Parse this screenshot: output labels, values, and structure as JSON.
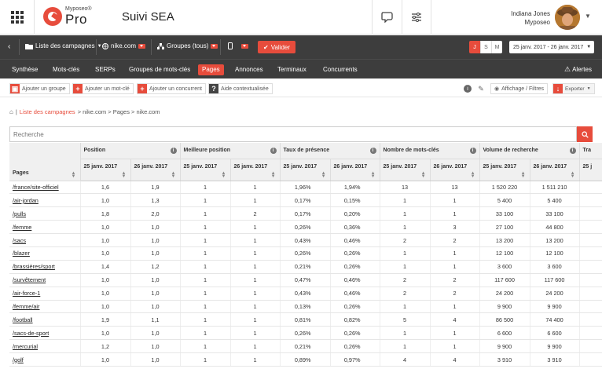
{
  "header": {
    "logo_small": "Myposeo®",
    "logo_big": "Pro",
    "title": "Suivi SEA",
    "user_name": "Indiana Jones",
    "user_org": "Myposeo"
  },
  "toolbar": {
    "campaigns": "Liste des campagnes",
    "domain": "nike.com",
    "groups": "Groupes (tous)",
    "valider": "Valider",
    "period_j": "J",
    "period_s": "S",
    "period_m": "M",
    "date_range": "25 janv. 2017 - 26 janv. 2017"
  },
  "menu": {
    "items": [
      "Synthèse",
      "Mots-clés",
      "SERPs",
      "Groupes de mots-clés",
      "Pages",
      "Annonces",
      "Terminaux",
      "Concurrents"
    ],
    "active": "Pages",
    "alertes": "Alertes"
  },
  "actions": {
    "add_group": "Ajouter un groupe",
    "add_keyword": "Ajouter un mot-clé",
    "add_competitor": "Ajouter un concurrent",
    "help": "Aide contextualisée",
    "display_filters": "Affichage / Filtres",
    "export": "Exporter"
  },
  "breadcrumb": {
    "link": "Liste des campagnes",
    "rest": "> nike.com > Pages > nike.com"
  },
  "search": {
    "placeholder": "Recherche"
  },
  "table": {
    "pages_header": "Pages",
    "groups": [
      "Position",
      "Meilleure position",
      "Taux de présence",
      "Nombre de mots-clés",
      "Volume de recherche",
      "Tra"
    ],
    "date1": "25 janv. 2017",
    "date2": "26 janv. 2017",
    "date3": "25 j",
    "rows": [
      {
        "page": "/france/site-officiel",
        "v": [
          "1,6",
          "1,9",
          "1",
          "1",
          "1,96%",
          "1,94%",
          "13",
          "13",
          "1 520 220",
          "1 511 210"
        ]
      },
      {
        "page": "/air-jordan",
        "v": [
          "1,0",
          "1,3",
          "1",
          "1",
          "0,17%",
          "0,15%",
          "1",
          "1",
          "5 400",
          "5 400"
        ]
      },
      {
        "page": "/pulls",
        "v": [
          "1,8",
          "2,0",
          "1",
          "2",
          "0,17%",
          "0,20%",
          "1",
          "1",
          "33 100",
          "33 100"
        ]
      },
      {
        "page": "/femme",
        "v": [
          "1,0",
          "1,0",
          "1",
          "1",
          "0,26%",
          "0,36%",
          "1",
          "3",
          "27 100",
          "44 800"
        ]
      },
      {
        "page": "/sacs",
        "v": [
          "1,0",
          "1,0",
          "1",
          "1",
          "0,43%",
          "0,46%",
          "2",
          "2",
          "13 200",
          "13 200"
        ]
      },
      {
        "page": "/blazer",
        "v": [
          "1,0",
          "1,0",
          "1",
          "1",
          "0,26%",
          "0,26%",
          "1",
          "1",
          "12 100",
          "12 100"
        ]
      },
      {
        "page": "/brassières/sport",
        "v": [
          "1,4",
          "1,2",
          "1",
          "1",
          "0,21%",
          "0,26%",
          "1",
          "1",
          "3 600",
          "3 600"
        ]
      },
      {
        "page": "/survêtement",
        "v": [
          "1,0",
          "1,0",
          "1",
          "1",
          "0,47%",
          "0,46%",
          "2",
          "2",
          "117 600",
          "117 600"
        ]
      },
      {
        "page": "/air-force-1",
        "v": [
          "1,0",
          "1,0",
          "1",
          "1",
          "0,43%",
          "0,46%",
          "2",
          "2",
          "24 200",
          "24 200"
        ]
      },
      {
        "page": "/femme/air",
        "v": [
          "1,0",
          "1,0",
          "1",
          "1",
          "0,13%",
          "0,26%",
          "1",
          "1",
          "9 900",
          "9 900"
        ]
      },
      {
        "page": "/football",
        "v": [
          "1,9",
          "1,1",
          "1",
          "1",
          "0,81%",
          "0,82%",
          "5",
          "4",
          "86 500",
          "74 400"
        ]
      },
      {
        "page": "/sacs-de-sport",
        "v": [
          "1,0",
          "1,0",
          "1",
          "1",
          "0,26%",
          "0,26%",
          "1",
          "1",
          "6 600",
          "6 600"
        ]
      },
      {
        "page": "/mercurial",
        "v": [
          "1,2",
          "1,0",
          "1",
          "1",
          "0,21%",
          "0,26%",
          "1",
          "1",
          "9 900",
          "9 900"
        ]
      },
      {
        "page": "/golf",
        "v": [
          "1,0",
          "1,0",
          "1",
          "1",
          "0,89%",
          "0,97%",
          "4",
          "4",
          "3 910",
          "3 910"
        ]
      }
    ]
  }
}
